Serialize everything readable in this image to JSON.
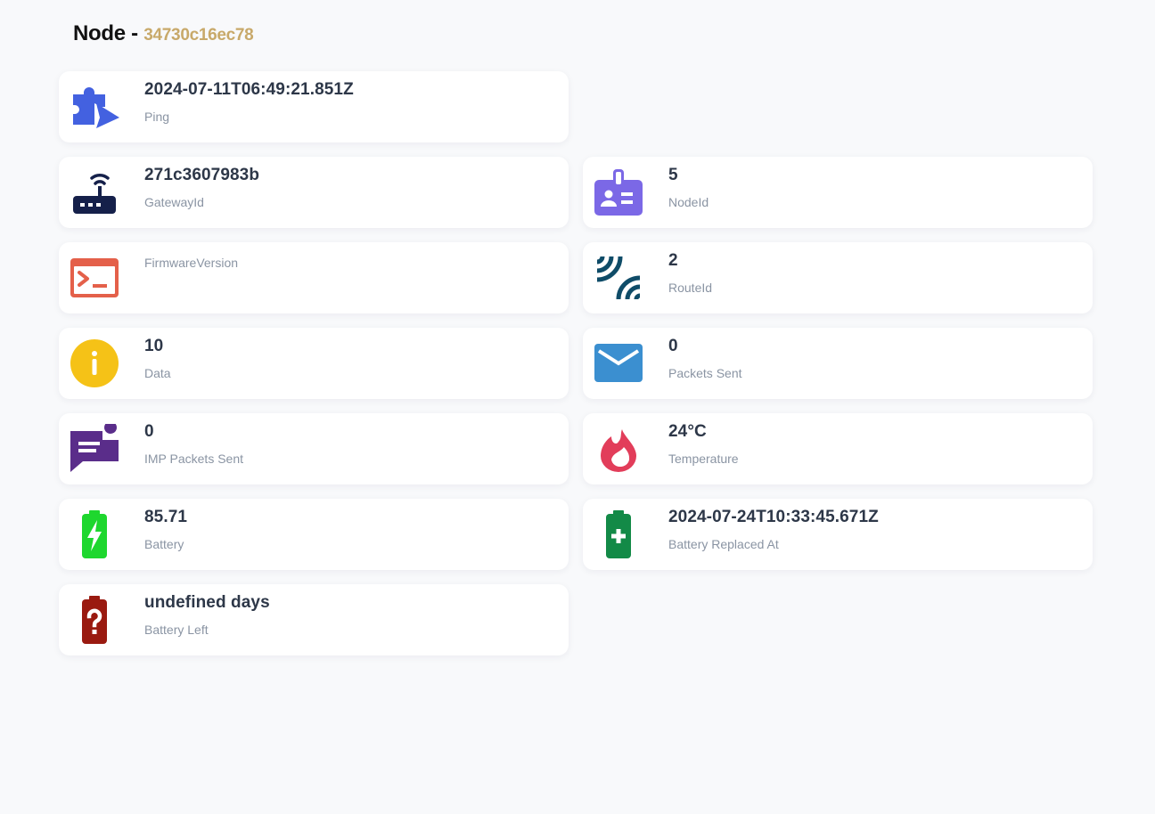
{
  "header": {
    "title": "Node -",
    "node_id": "34730c16ec78"
  },
  "cards": {
    "ping": {
      "value": "2024-07-11T06:49:21.851Z",
      "label": "Ping",
      "icon": "puzzle-send-icon",
      "color": "#4361e0"
    },
    "gateway": {
      "value": "271c3607983b",
      "label": "GatewayId",
      "icon": "router-icon",
      "color": "#15204a"
    },
    "node": {
      "value": "5",
      "label": "NodeId",
      "icon": "id-badge-icon",
      "color": "#7b68e6"
    },
    "firmware": {
      "value": "",
      "label": "FirmwareVersion",
      "icon": "terminal-icon",
      "color": "#e4604a"
    },
    "route": {
      "value": "2",
      "label": "RouteId",
      "icon": "signal-waves-icon",
      "color": "#0f4c68"
    },
    "data": {
      "value": "10",
      "label": "Data",
      "icon": "info-circle-icon",
      "color": "#f5c217"
    },
    "packets": {
      "value": "0",
      "label": "Packets Sent",
      "icon": "envelope-icon",
      "color": "#3b8fd0"
    },
    "imp_packets": {
      "value": "0",
      "label": "IMP Packets Sent",
      "icon": "chat-notification-icon",
      "color": "#5a2d8a"
    },
    "temperature": {
      "value": "24°C",
      "label": "Temperature",
      "icon": "flame-icon",
      "color": "#e23d5a"
    },
    "battery": {
      "value": "85.71",
      "label": "Battery",
      "icon": "battery-charging-icon",
      "color": "#1ed72e"
    },
    "battery_replaced": {
      "value": "2024-07-24T10:33:45.671Z",
      "label": "Battery Replaced At",
      "icon": "battery-plus-icon",
      "color": "#138a47"
    },
    "battery_left": {
      "value": "undefined days",
      "label": "Battery Left",
      "icon": "battery-question-icon",
      "color": "#9a1a10"
    }
  }
}
